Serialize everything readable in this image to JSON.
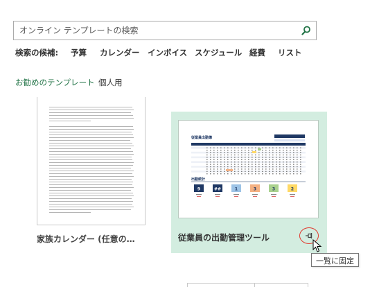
{
  "search": {
    "placeholder": "オンライン テンプレートの検索",
    "value": ""
  },
  "suggestions": {
    "label": "検索の候補:",
    "items": [
      "予算",
      "カレンダー",
      "インボイス",
      "スケジュール",
      "経費",
      "リスト"
    ]
  },
  "filters": {
    "items": [
      "お勧めのテンプレート",
      "個人用"
    ],
    "active_index": 0
  },
  "templates": [
    {
      "name": "家族カレンダー (任意の…",
      "selected": false
    },
    {
      "name": "従業員の出勤管理ツール",
      "selected": true
    }
  ],
  "preview": {
    "header_title": "従業員出勤簿",
    "summary_title": "出勤統計",
    "summary_values": [
      "9",
      "##",
      "1",
      "3",
      "3",
      "2"
    ],
    "summary_colors": [
      "#1f3864",
      "#1f3864",
      "#9dc3e6",
      "#f4b183",
      "#a9d18e",
      "#ffd966"
    ]
  },
  "tooltip": {
    "text": "一覧に固定"
  },
  "colors": {
    "accent": "#217346",
    "selected_bg": "#d3ede0",
    "highlight_circle": "#e03a2f"
  },
  "icons": {
    "search": "search-icon",
    "pin": "pin-icon",
    "cursor": "mouse-cursor-icon"
  }
}
